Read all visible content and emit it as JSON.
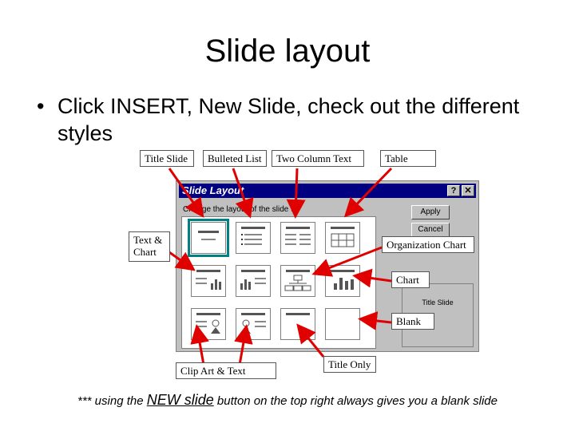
{
  "title": "Slide layout",
  "bullet": {
    "symbol": "•",
    "text": "Click INSERT, New Slide, check out the different styles"
  },
  "dialog": {
    "title": "Slide Layout",
    "help_glyph": "?",
    "close_glyph": "✕",
    "prompt": "Change the layout of the slide to:",
    "apply_label": "Apply",
    "cancel_label": "Cancel",
    "preview_caption": "Title Slide"
  },
  "callouts": {
    "title_slide": "Title Slide",
    "bulleted_list": "Bulleted List",
    "two_column_text": "Two Column Text",
    "table": "Table",
    "text_chart": "Text & Chart",
    "organization_chart": "Organization Chart",
    "chart": "Chart",
    "blank": "Blank",
    "clip_art_text": "Clip Art & Text",
    "title_only": "Title Only"
  },
  "footnote": {
    "prefix": "*** using the",
    "link": "NEW slide",
    "suffix": "button on the top right always gives you a blank slide"
  },
  "colors": {
    "arrow": "#e00000",
    "titlebar": "#000080",
    "selection": "#008080"
  }
}
